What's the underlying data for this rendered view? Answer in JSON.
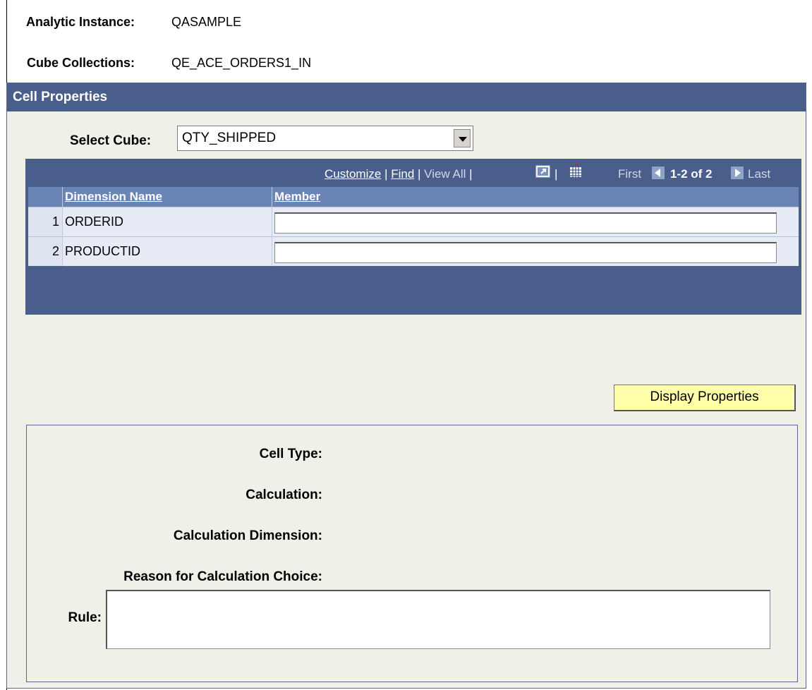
{
  "header": {
    "analytic_instance_label": "Analytic Instance:",
    "analytic_instance_value": "QASAMPLE",
    "cube_collections_label": "Cube Collections:",
    "cube_collections_value": "QE_ACE_ORDERS1_IN"
  },
  "panel": {
    "title": "Cell Properties",
    "select_cube_label": "Select Cube:",
    "select_cube_value": "QTY_SHIPPED"
  },
  "grid": {
    "nav": {
      "customize": "Customize",
      "find": "Find",
      "view_all": "View All",
      "first": "First",
      "range": "1-2 of 2",
      "last": "Last",
      "separator": "|"
    },
    "columns": [
      "Dimension Name",
      "Member"
    ],
    "rows": [
      {
        "num": "1",
        "name": "ORDERID",
        "member": ""
      },
      {
        "num": "2",
        "name": "PRODUCTID",
        "member": ""
      }
    ]
  },
  "display_button": "Display Properties",
  "properties": {
    "cell_type": "Cell Type:",
    "calculation": "Calculation:",
    "calculation_dimension": "Calculation Dimension:",
    "reason": "Reason for Calculation Choice:",
    "rule": "Rule:"
  },
  "colors": {
    "header_bar": "#4a5e8c",
    "column_header": "#6a84b6",
    "panel_bg": "#f0f0e9",
    "button_bg": "#ffffaa"
  },
  "icons": [
    "zoom-icon",
    "download-grid-icon",
    "previous-icon",
    "next-icon",
    "dropdown-arrow-icon"
  ]
}
